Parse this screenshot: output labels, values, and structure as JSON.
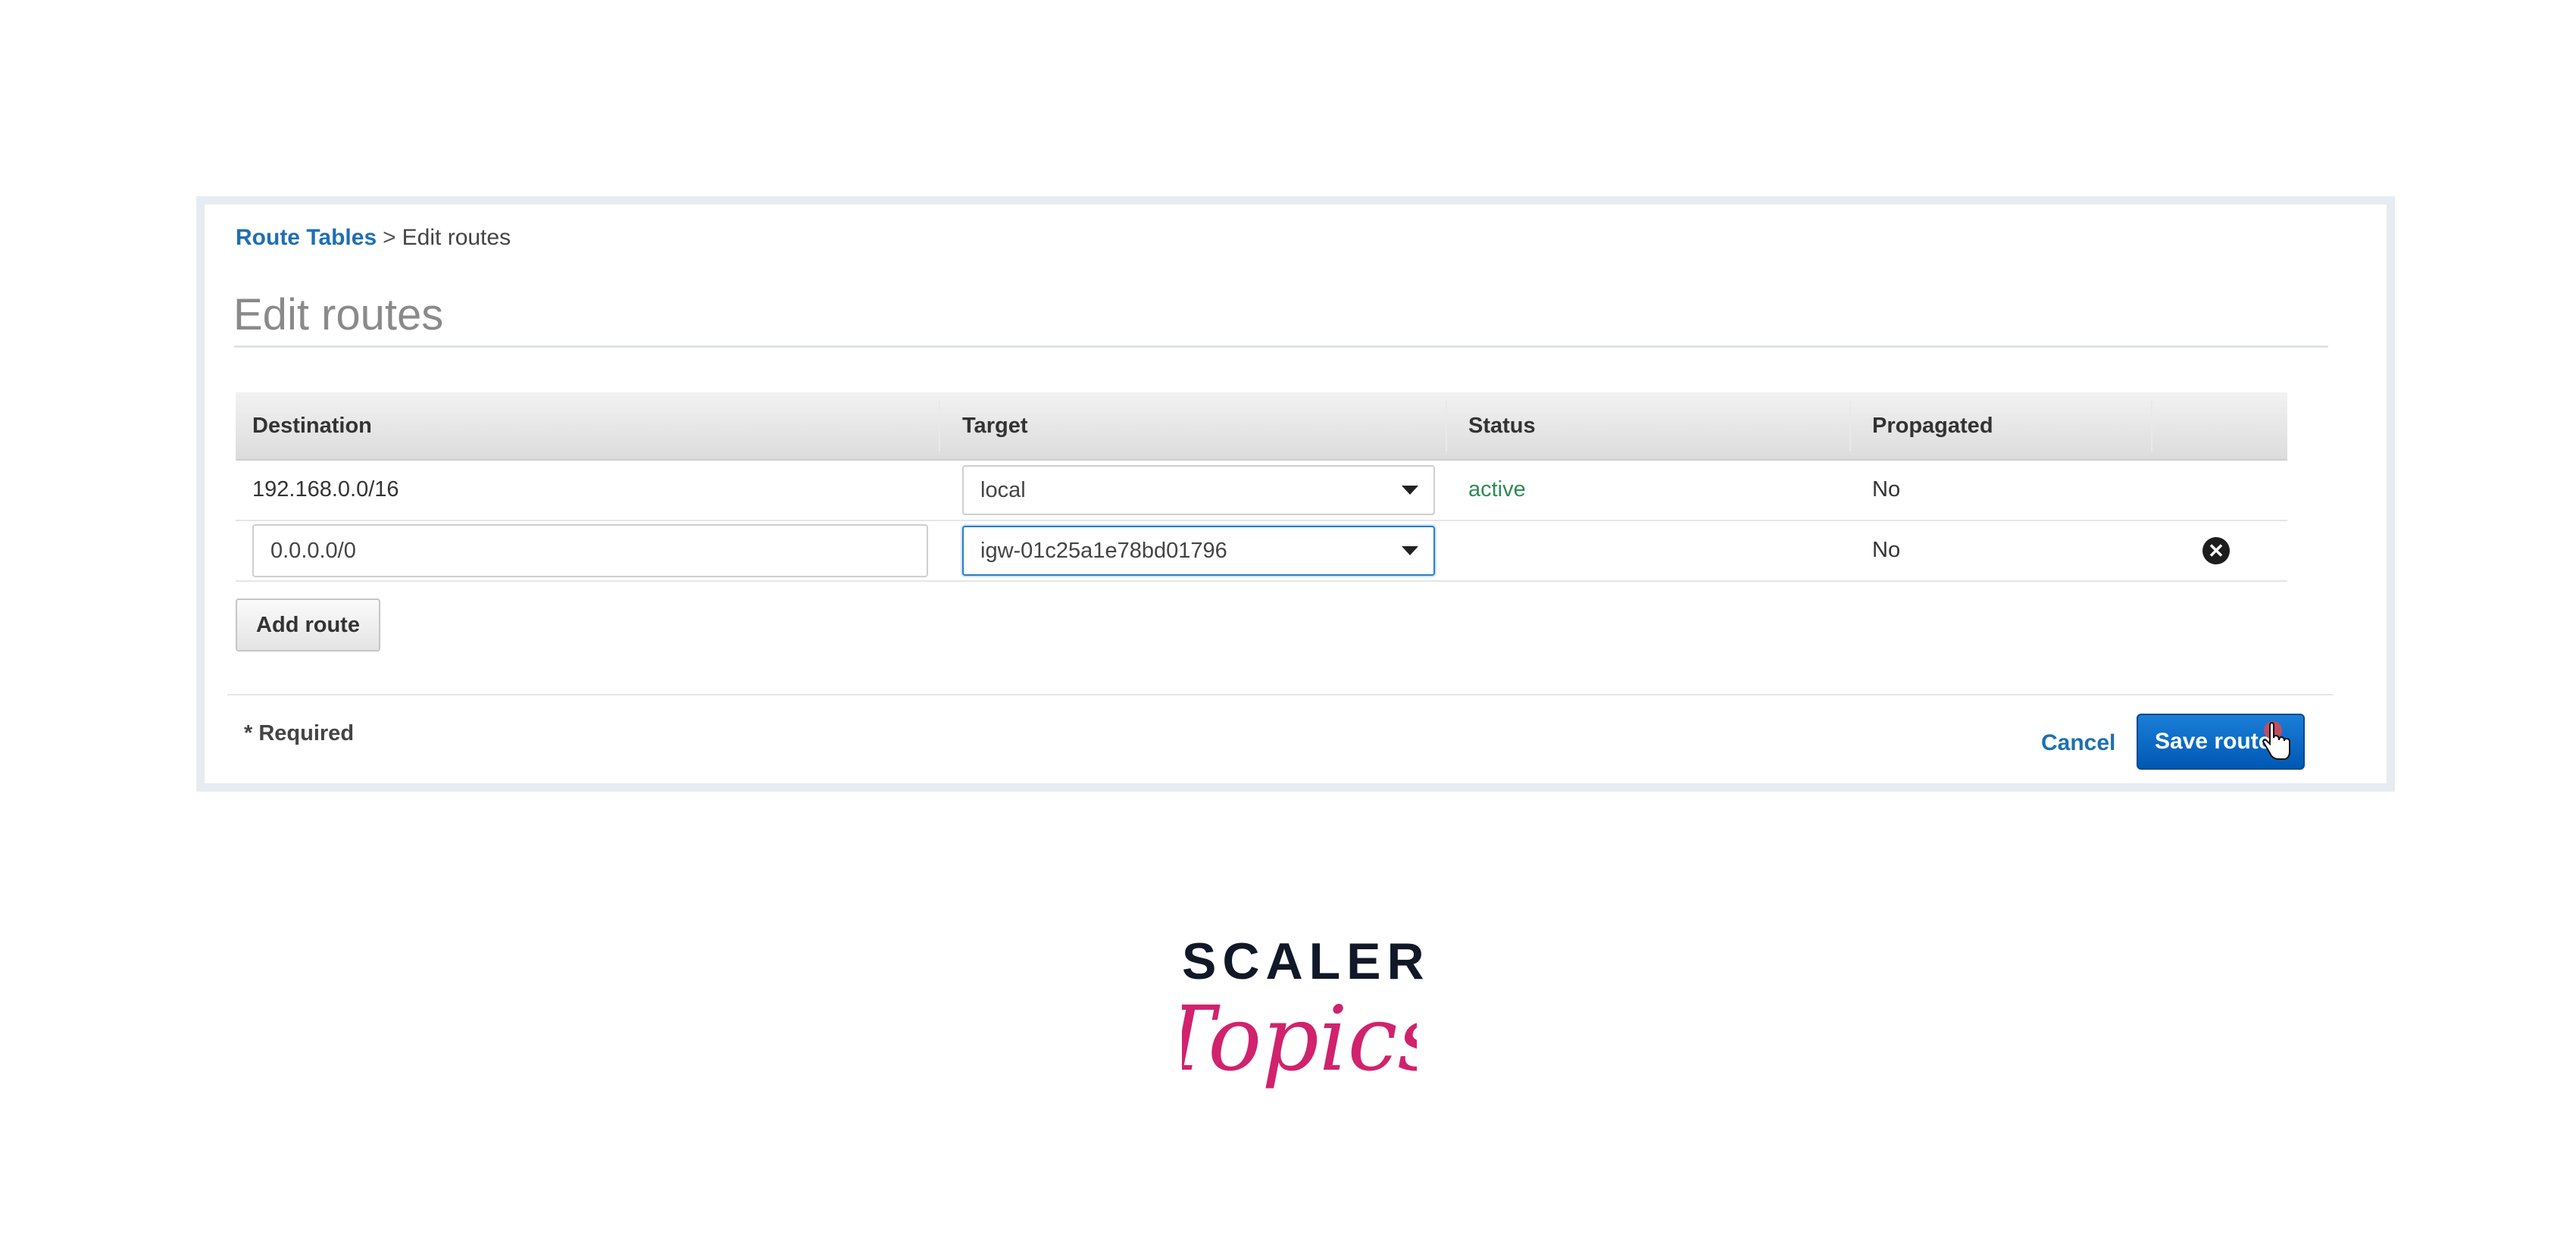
{
  "breadcrumb": {
    "link": "Route Tables",
    "separator": ">",
    "current": "Edit routes"
  },
  "page_title": "Edit routes",
  "table": {
    "columns": [
      "Destination",
      "Target",
      "Status",
      "Propagated"
    ],
    "rows": [
      {
        "destination": "192.168.0.0/16",
        "target": "local",
        "status": "active",
        "propagated": "No",
        "editable": false
      },
      {
        "destination": "0.0.0.0/0",
        "target": "igw-01c25a1e78bd01796",
        "status": "",
        "propagated": "No",
        "editable": true
      }
    ]
  },
  "buttons": {
    "add_route": "Add route",
    "cancel": "Cancel",
    "save_routes": "Save routes"
  },
  "required_note": "* Required",
  "logo": {
    "top": "SCALER",
    "script": "Topics"
  },
  "colors": {
    "link": "#1f6fb2",
    "status_active": "#2e8b57",
    "primary_button": "#0a6fd0",
    "brand_script": "#d1226d"
  },
  "icons": [
    "chevron-down-icon",
    "remove-circle-icon",
    "hand-pointer-icon"
  ]
}
